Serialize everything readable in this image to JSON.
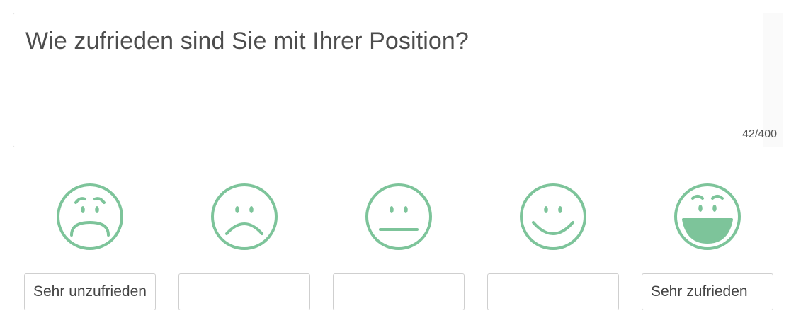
{
  "question": {
    "text": "Wie zufrieden sind Sie mit Ihrer Position?",
    "counter": "42/400"
  },
  "scale": {
    "accent_color": "#7dc49a",
    "options": [
      {
        "icon": "very-sad-face-icon",
        "label_value": "Sehr unzufrieden",
        "placeholder": ""
      },
      {
        "icon": "sad-face-icon",
        "label_value": "",
        "placeholder": ""
      },
      {
        "icon": "neutral-face-icon",
        "label_value": "",
        "placeholder": ""
      },
      {
        "icon": "happy-face-icon",
        "label_value": "",
        "placeholder": ""
      },
      {
        "icon": "very-happy-face-icon",
        "label_value": "Sehr zufrieden",
        "placeholder": ""
      }
    ]
  }
}
